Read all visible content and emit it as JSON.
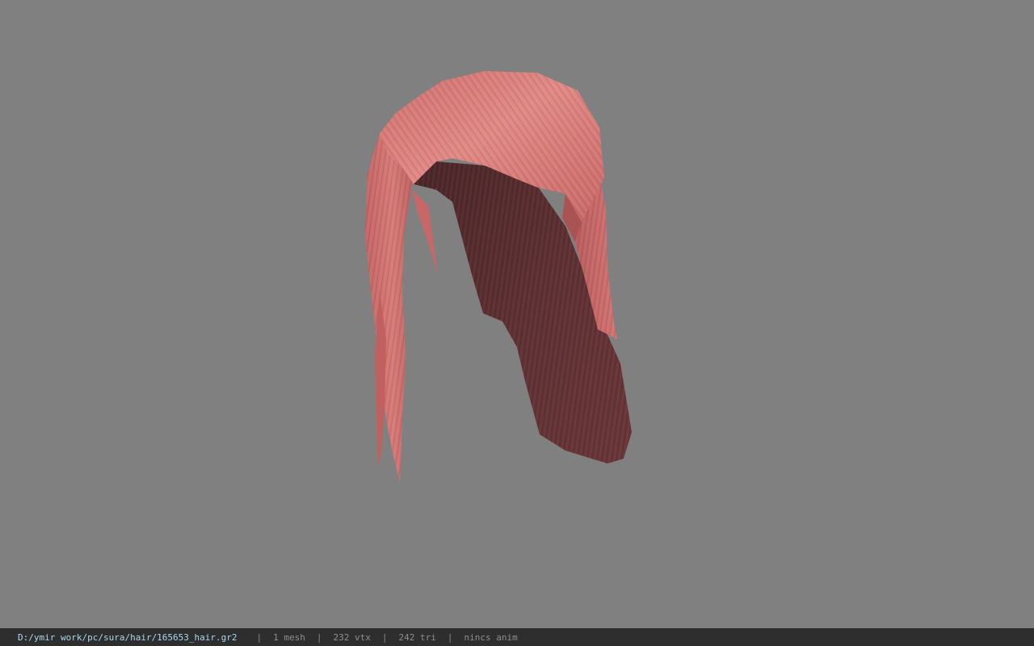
{
  "viewer": {
    "background_color": "#808080",
    "model_colors": {
      "hair_light": "#d77876",
      "hair_mid": "#b45a5b",
      "hair_dark": "#5e3033"
    }
  },
  "status_bar": {
    "file_path": "D:/ymir work/pc/sura/hair/165653_hair.gr2",
    "separator": "|",
    "mesh_count": "1 mesh",
    "vertex_count": "232 vtx",
    "triangle_count": "242 tri",
    "animation_status": "nincs anim",
    "path_color": "#a9d6ee"
  }
}
